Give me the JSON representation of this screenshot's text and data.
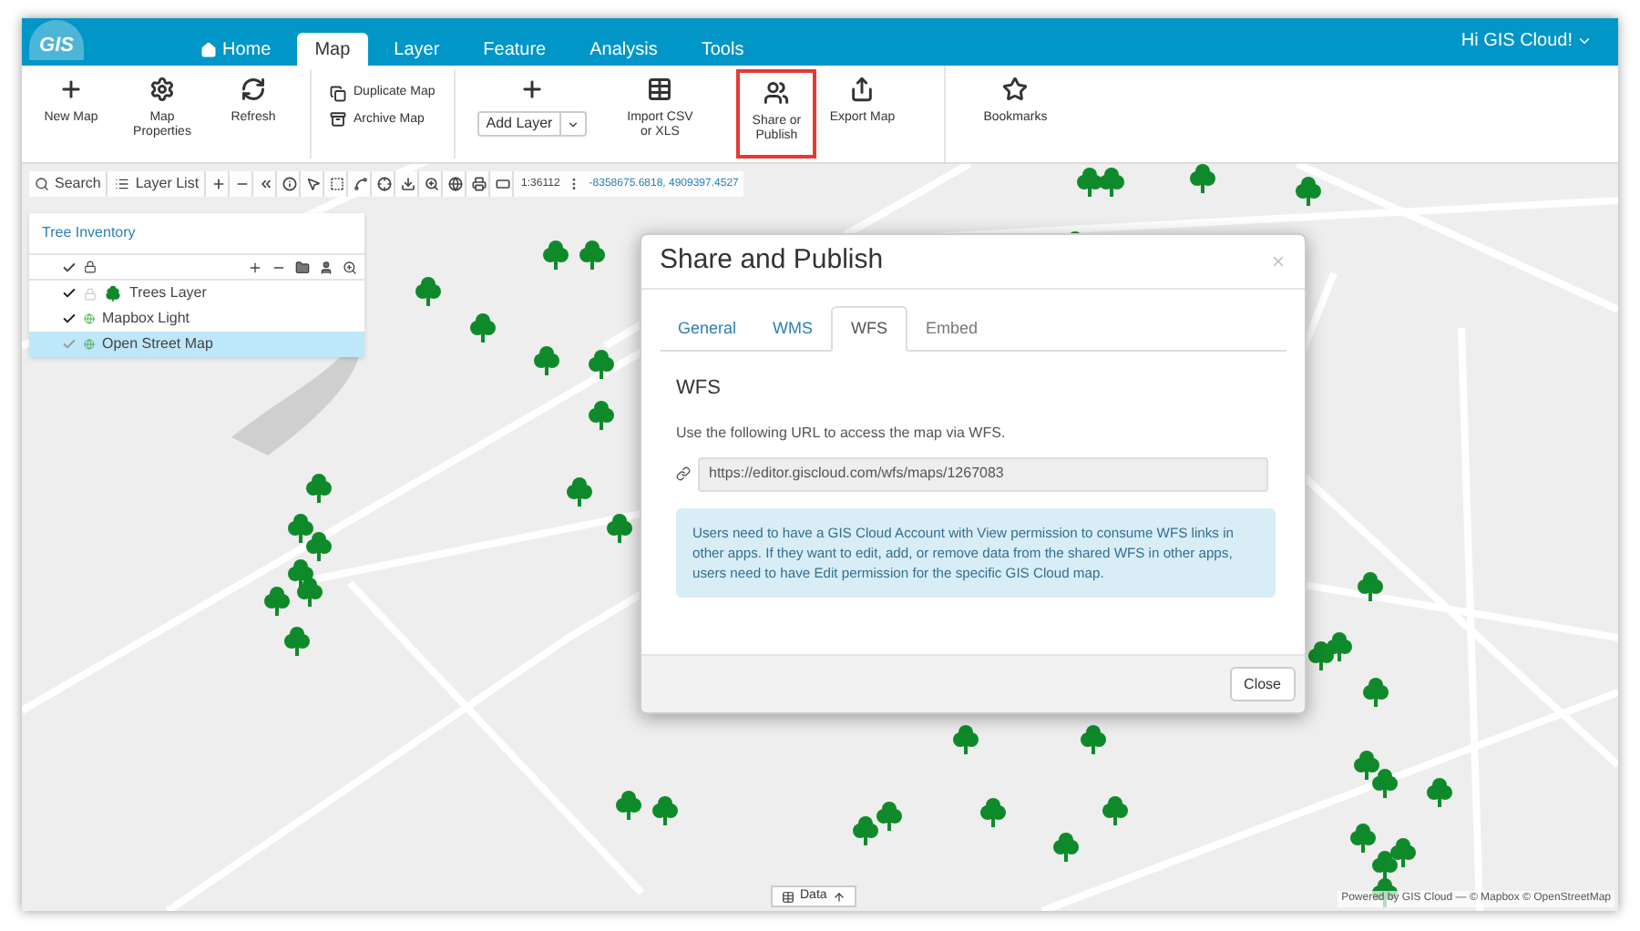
{
  "header": {
    "logo": "GIS",
    "tabs": [
      {
        "label": "Home",
        "selected": false,
        "kind": "home"
      },
      {
        "label": "Map",
        "selected": true,
        "kind": "plain"
      },
      {
        "label": "Layer",
        "selected": false,
        "kind": "plain"
      },
      {
        "label": "Feature",
        "selected": false,
        "kind": "plain"
      },
      {
        "label": "Analysis",
        "selected": false,
        "kind": "plain"
      },
      {
        "label": "Tools",
        "selected": false,
        "kind": "plain"
      }
    ],
    "user": "Hi GIS Cloud!"
  },
  "ribbon": [
    {
      "kind": "big",
      "label": "New Map",
      "highlighted": false
    },
    {
      "kind": "big",
      "label": "Map Properties",
      "highlighted": false
    },
    {
      "kind": "big",
      "label": "Refresh",
      "highlighted": false
    },
    {
      "kind": "small",
      "items": [
        {
          "label": "Duplicate Map"
        },
        {
          "label": "Archive Map"
        }
      ]
    },
    {
      "kind": "dropdown",
      "label": "Add Layer"
    },
    {
      "kind": "big",
      "label": "Import CSV or XLS",
      "highlighted": false
    },
    {
      "kind": "big",
      "label": "Share or Publish",
      "highlighted": true
    },
    {
      "kind": "big",
      "label": "Export Map",
      "highlighted": false
    },
    {
      "kind": "big",
      "label": "Bookmarks",
      "highlighted": false
    }
  ],
  "map_toolbar": {
    "search": "Search",
    "layer_list": "Layer List",
    "scale": "1:36112",
    "coordinates": "-8358675.6818, 4909397.4527"
  },
  "layer_panel": {
    "title": "Tree Inventory",
    "layers": [
      {
        "name": "Trees Layer",
        "checked": true,
        "selected": false,
        "kind": "trees"
      },
      {
        "name": "Mapbox Light",
        "checked": true,
        "selected": false,
        "kind": "basemap"
      },
      {
        "name": "Open Street Map",
        "checked": true,
        "selected": true,
        "kind": "basemap"
      }
    ]
  },
  "dialog": {
    "title": "Share and Publish",
    "tabs": [
      {
        "label": "General",
        "selected": false
      },
      {
        "label": "WMS",
        "selected": false
      },
      {
        "label": "WFS",
        "selected": true
      },
      {
        "label": "Embed",
        "selected": false
      }
    ],
    "heading": "WFS",
    "text": "Use the following URL to access the map via WFS.",
    "url": "https://editor.giscloud.com/wfs/maps/1267083",
    "info": "Users need to have a GIS Cloud Account with View permission to consume WFS links in other apps. If they want to edit, add, or remove data from the shared WFS in other apps, users need to have Edit permission for the specific GIS Cloud map.",
    "close_button": "Close"
  },
  "data_button": "Data",
  "attribution": "Powered by GIS Cloud — © Mapbox © OpenStreetMap"
}
